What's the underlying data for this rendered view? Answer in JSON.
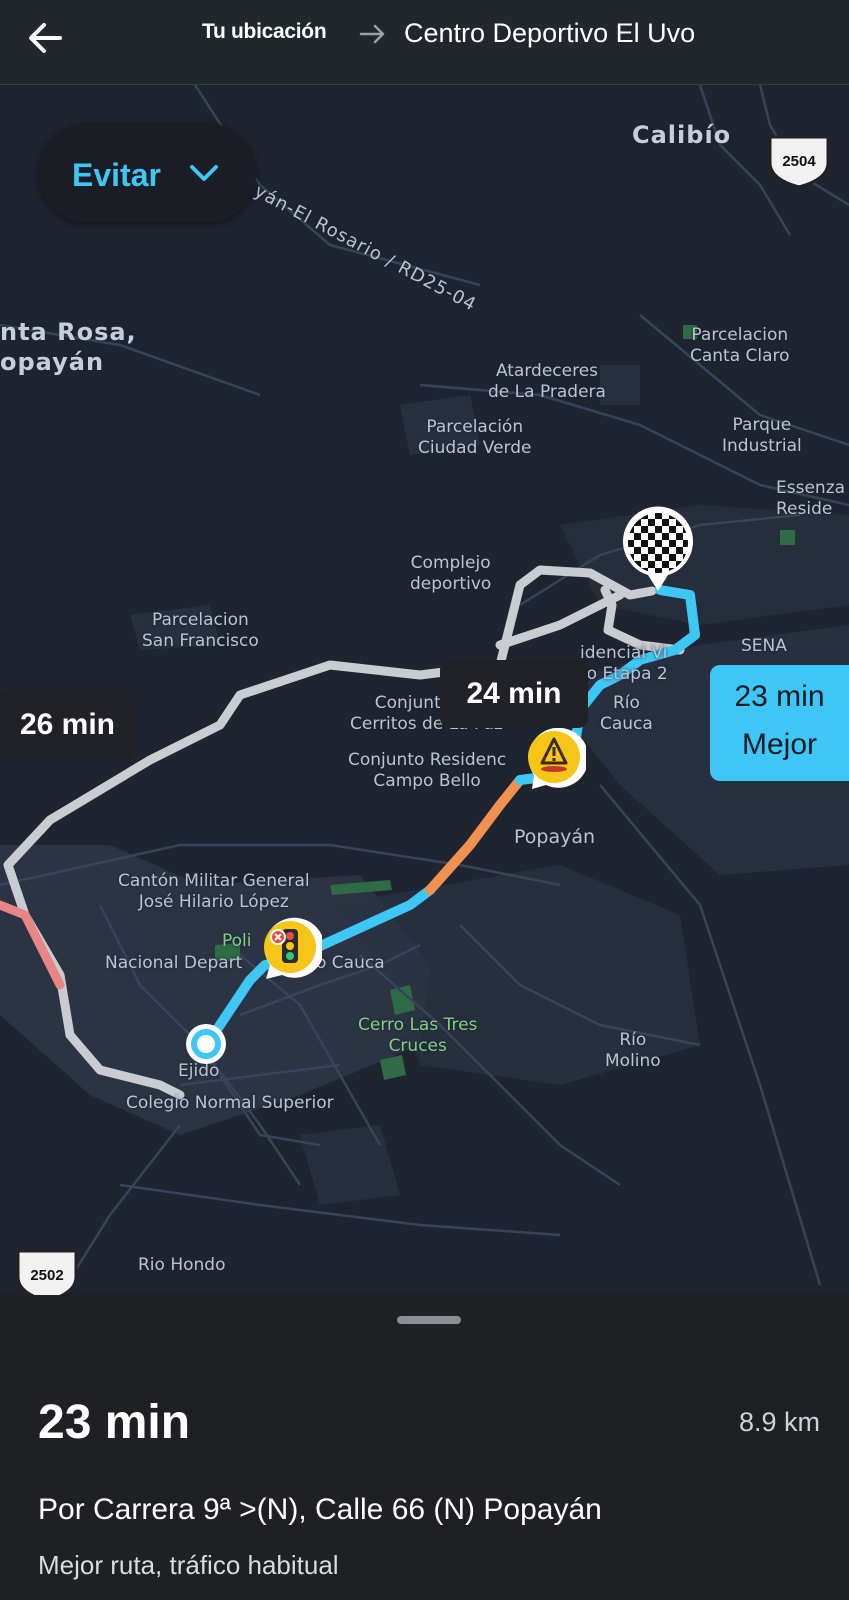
{
  "header": {
    "origin": "Tu ubicación",
    "destination": "Centro Deportivo El Uvo"
  },
  "map": {
    "avoid_label": "Evitar",
    "route_times": {
      "alt1": "26 min",
      "alt2": "24 min",
      "best_time": "23 min",
      "best_label": "Mejor"
    },
    "shield_top": "2504",
    "shield_bottom": "2502",
    "places": {
      "calibio": "Calibío",
      "road": "ayán-El Rosario / RD25-04",
      "santa_rosa_1": "nta Rosa,",
      "santa_rosa_2": "opayán",
      "parcelacion_canta_claro_1": "Parcelacion",
      "parcelacion_canta_claro_2": "Canta Claro",
      "atardeceres_1": "Atardeceres",
      "atardeceres_2": "de La Pradera",
      "ciudad_verde_1": "Parcelación",
      "ciudad_verde_2": "Ciudad Verde",
      "parque_1": "Parque",
      "parque_2": "Industrial",
      "essenza_1": "Essenza",
      "essenza_2": "Reside",
      "complejo_1": "Complejo",
      "complejo_2": "deportivo",
      "san_francisco_1": "Parcelacion",
      "san_francisco_2": "San Francisco",
      "sena": "SENA",
      "residencial_1": "idencial Vi",
      "residencial_2": "to Etapa 2",
      "cerritos_1": "Conjunto Re",
      "cerritos_2": "Cerritos de La Paz",
      "rio_cauca_1": "Río",
      "rio_cauca_2": "Cauca",
      "campo_bello_1": "Conjunto Residenc",
      "campo_bello_2": "Campo Bello",
      "popayan": "Popayán",
      "canton_1": "Cantón Militar General",
      "canton_2": "José Hilario López",
      "policia_1": "Poli",
      "policia_2": "Nacional Depart",
      "policia_3": "o Cauca",
      "cerro_1": "Cerro Las Tres",
      "cerro_2": "Cruces",
      "rio_molino_1": "Río",
      "rio_molino_2": "Molino",
      "ejido": "Ejido",
      "colegio": "Colegio Normal Superior",
      "rio_hondo": "Rio Hondo"
    }
  },
  "summary": {
    "eta": "23 min",
    "distance": "8.9 km",
    "via": "Por Carrera 9ª >(N), Calle 66 (N) Popayán",
    "note": "Mejor ruta, tráfico habitual"
  },
  "colors": {
    "route_best": "#3ec6f5",
    "route_alt": "#c9ccd1",
    "traffic_slow": "#f0914f",
    "traffic_heavy": "#e98585",
    "marker_yellow": "#f5c518"
  }
}
